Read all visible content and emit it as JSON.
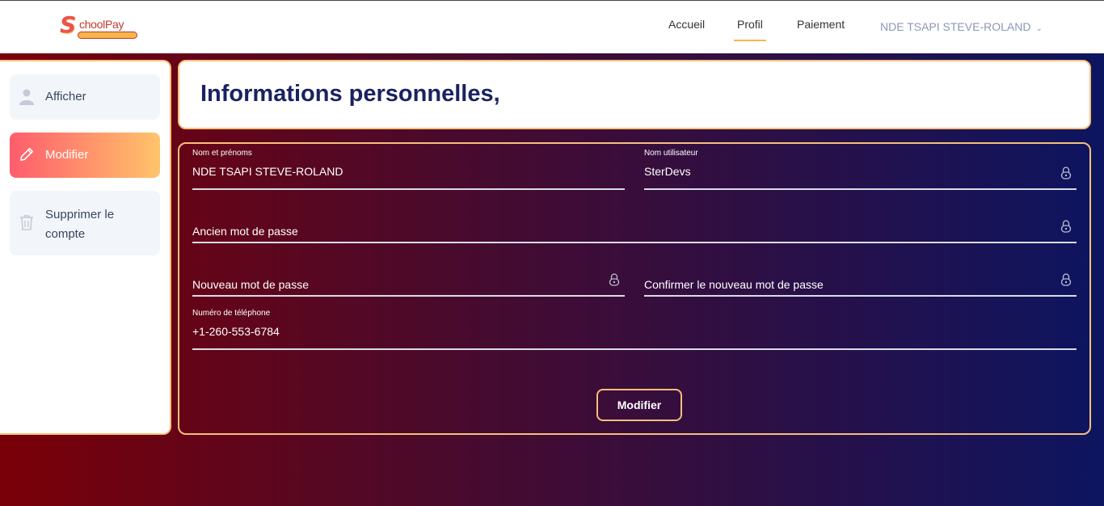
{
  "navbar": {
    "logo_text": "SchoolPay",
    "items": [
      {
        "label": "Accueil"
      },
      {
        "label": "Profil"
      },
      {
        "label": "Paiement"
      }
    ],
    "user_label": "NDE TSAPI STEVE-ROLAND"
  },
  "sidebar": {
    "items": [
      {
        "label": "Afficher",
        "icon": "user-icon"
      },
      {
        "label": "Modifier",
        "icon": "pencil-icon"
      },
      {
        "label": "Supprimer le compte",
        "label_line1": "Supprimer le",
        "label_line2": "compte",
        "icon": "trash-icon"
      }
    ]
  },
  "header": {
    "title": "Informations personnelles,"
  },
  "form": {
    "full_name": {
      "label": "Nom et prénoms",
      "value": "NDE TSAPI STEVE-ROLAND"
    },
    "username": {
      "label": "Nom utilisateur",
      "value": "SterDevs"
    },
    "old_password": {
      "placeholder": "Ancien mot de passe"
    },
    "new_password": {
      "placeholder": "Nouveau mot de passe"
    },
    "confirm_password": {
      "placeholder": "Confirmer le nouveau mot de passe"
    },
    "phone": {
      "label": "Numéro de téléphone",
      "value": "+1-260-553-6784"
    },
    "submit_label": "Modifier"
  },
  "colors": {
    "accent": "#f6c07a",
    "title": "#1a2360",
    "gradient_left": "#7a0008",
    "gradient_right": "#0d1560",
    "active_gradient_start": "#ff5c6c",
    "active_gradient_end": "#ffc46b"
  }
}
